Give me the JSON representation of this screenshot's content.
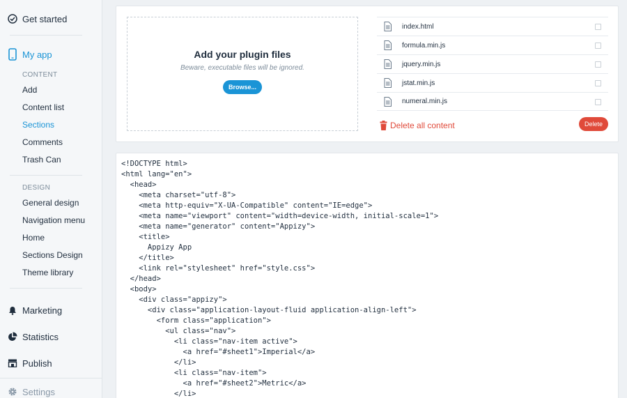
{
  "sidebar": {
    "get_started": "Get started",
    "my_app": "My app",
    "content_section": "CONTENT",
    "content_items": [
      "Add",
      "Content list",
      "Sections",
      "Comments",
      "Trash Can"
    ],
    "design_section": "DESIGN",
    "design_items": [
      "General design",
      "Navigation menu",
      "Home",
      "Sections Design",
      "Theme library"
    ],
    "marketing": "Marketing",
    "statistics": "Statistics",
    "publish": "Publish",
    "settings": "Settings",
    "active_item": "Sections"
  },
  "upload": {
    "title": "Add your plugin files",
    "subtitle": "Beware, executable files will be ignored.",
    "browse_label": "Browse..."
  },
  "files": [
    "index.html",
    "formula.min.js",
    "jquery.min.js",
    "jstat.min.js",
    "numeral.min.js"
  ],
  "actions": {
    "delete_all_label": "Delete all content",
    "delete_label": "Delete"
  },
  "code": [
    "<!DOCTYPE html>",
    "<html lang=\"en\">",
    "  <head>",
    "    <meta charset=\"utf-8\">",
    "    <meta http-equiv=\"X-UA-Compatible\" content=\"IE=edge\">",
    "    <meta name=\"viewport\" content=\"width=device-width, initial-scale=1\">",
    "    <meta name=\"generator\" content=\"Appizy\">",
    "    <title>",
    "      Appizy App",
    "    </title>",
    "    <link rel=\"stylesheet\" href=\"style.css\">",
    "  </head>",
    "  <body>",
    "    <div class=\"appizy\">",
    "      <div class=\"application-layout-fluid application-align-left\">",
    "        <form class=\"application\">",
    "          <ul class=\"nav\">",
    "            <li class=\"nav-item active\">",
    "              <a href=\"#sheet1\">Imperial</a>",
    "            </li>",
    "            <li class=\"nav-item\">",
    "              <a href=\"#sheet2\">Metric</a>",
    "            </li>"
  ],
  "colors": {
    "accent": "#1a94d6",
    "danger": "#e04a3a",
    "text": "#1f2d3d",
    "muted": "#7d8c9a"
  }
}
